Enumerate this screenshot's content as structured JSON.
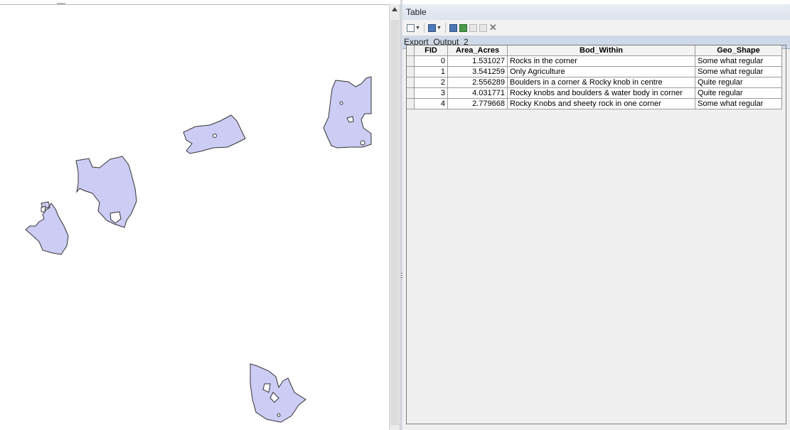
{
  "window": {
    "title": "Table"
  },
  "toolbar": {
    "buttons": [
      "table-options",
      "related-tables",
      "select-by-attributes",
      "switch-selection",
      "clear-selection",
      "zoom-to-selected",
      "delete-selected"
    ]
  },
  "tab": {
    "label": "Export_Output_2"
  },
  "table": {
    "columns": [
      "FID",
      "Area_Acres",
      "Bod_Within",
      "Geo_Shape"
    ],
    "rows": [
      {
        "fid": "0",
        "area": "1.531027",
        "bod": "Rocks in the corner",
        "geo": "Some what regular"
      },
      {
        "fid": "1",
        "area": "3.541259",
        "bod": "Only Agriculture",
        "geo": "Some what regular"
      },
      {
        "fid": "2",
        "area": "2.556289",
        "bod": "Boulders in a corner & Rocky knob in centre",
        "geo": "Quite regular"
      },
      {
        "fid": "3",
        "area": "4.031771",
        "bod": "Rocky knobs and boulders & water body in corner",
        "geo": "Quite regular"
      },
      {
        "fid": "4",
        "area": "2.779668",
        "bod": "Rocky Knobs and sheety rock in one corner",
        "geo": "Some what regular"
      }
    ]
  },
  "colors": {
    "polygon_fill": "#ccccf5",
    "polygon_stroke": "#333333",
    "title_bg": "#e4e9f1",
    "tab_bg": "#cfd9e8"
  }
}
